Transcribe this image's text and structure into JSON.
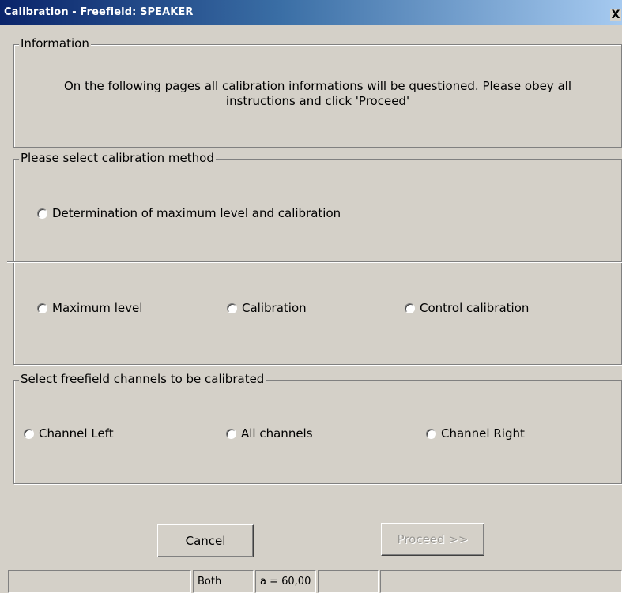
{
  "window": {
    "title": "Calibration - Freefield: SPEAKER",
    "close_glyph": "X"
  },
  "info_group": {
    "legend": "Information",
    "text": "On the following pages all calibration informations will be questioned. Please obey all instructions and click 'Proceed'"
  },
  "method_group": {
    "legend": "Please select calibration method",
    "combined_option": "Determination of maximum level and calibration",
    "options": [
      {
        "accel": "M",
        "rest": "aximum level"
      },
      {
        "accel": "C",
        "rest": "alibration"
      },
      {
        "pre": "C",
        "accel": "o",
        "rest": "ntrol calibration"
      }
    ]
  },
  "channel_group": {
    "legend": "Select freefield channels to be calibrated",
    "options": [
      "Channel Left",
      "All channels",
      "Channel Right"
    ]
  },
  "buttons": {
    "cancel_accel": "C",
    "cancel_rest": "ancel",
    "proceed": "Proceed >>"
  },
  "status": {
    "cells": [
      "",
      "Both",
      "a = 60,00",
      "",
      ""
    ]
  }
}
